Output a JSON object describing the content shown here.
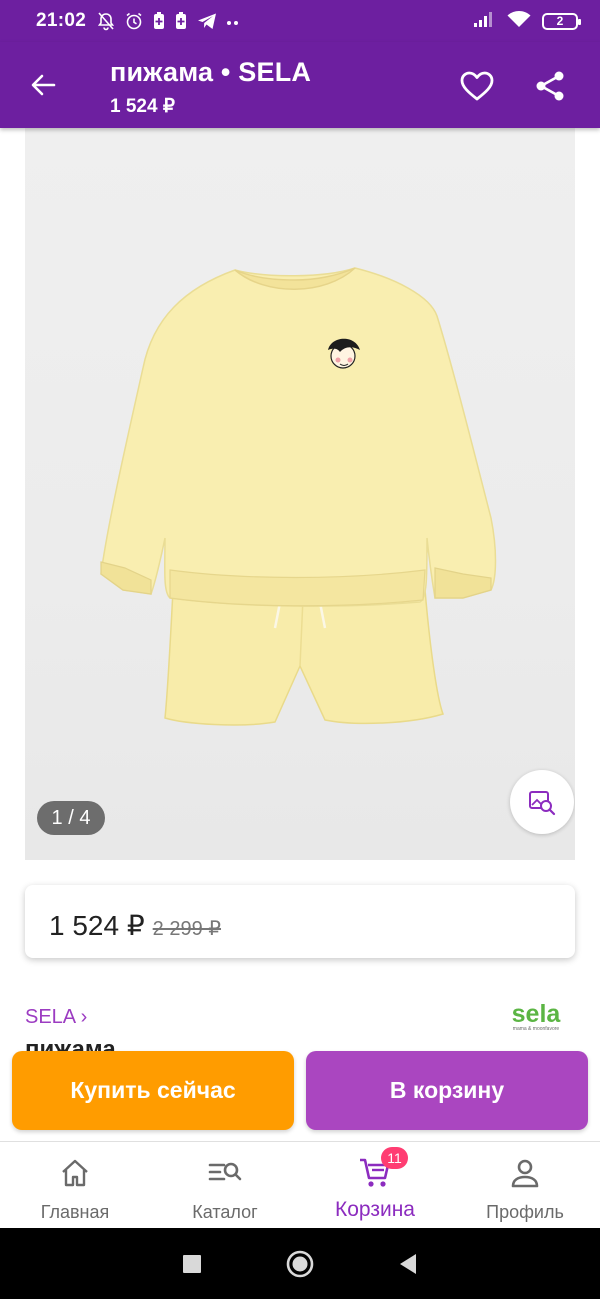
{
  "status_bar": {
    "time": "21:02",
    "battery": "2",
    "icons": [
      "mute-icon",
      "alarm-icon",
      "battery-saver-icon",
      "battery-saver-icon",
      "telegram-icon",
      "more-dots-icon",
      "signal-icon",
      "wifi-icon",
      "battery-icon"
    ]
  },
  "app_bar": {
    "title": "пижама • SELA",
    "subtitle": "1 524 ₽",
    "background": "#6d1fa0"
  },
  "gallery": {
    "counter": "1 / 4",
    "image_subject": "pale yellow kids pajama set: sweatshirt and shorts"
  },
  "price": {
    "current": "1 524 ₽",
    "old": "2 299 ₽"
  },
  "brand": {
    "link": "SELA ›",
    "logo_name": "sela",
    "logo_tagline": "mama & moonfavore",
    "logo_color": "#5bb544"
  },
  "product": {
    "name": "пижама"
  },
  "actions": {
    "buy_now": "Купить сейчас",
    "to_cart": "В корзину",
    "buy_color": "#ff9c00",
    "cart_color": "#aa46c0"
  },
  "bottom_nav": {
    "items": [
      {
        "label": "Главная",
        "icon": "home-icon"
      },
      {
        "label": "Каталог",
        "icon": "catalog-search-icon"
      },
      {
        "label": "Корзина",
        "icon": "cart-icon",
        "badge": "11",
        "active": true
      },
      {
        "label": "Профиль",
        "icon": "profile-icon"
      }
    ],
    "active_color": "#8c2cbf"
  }
}
